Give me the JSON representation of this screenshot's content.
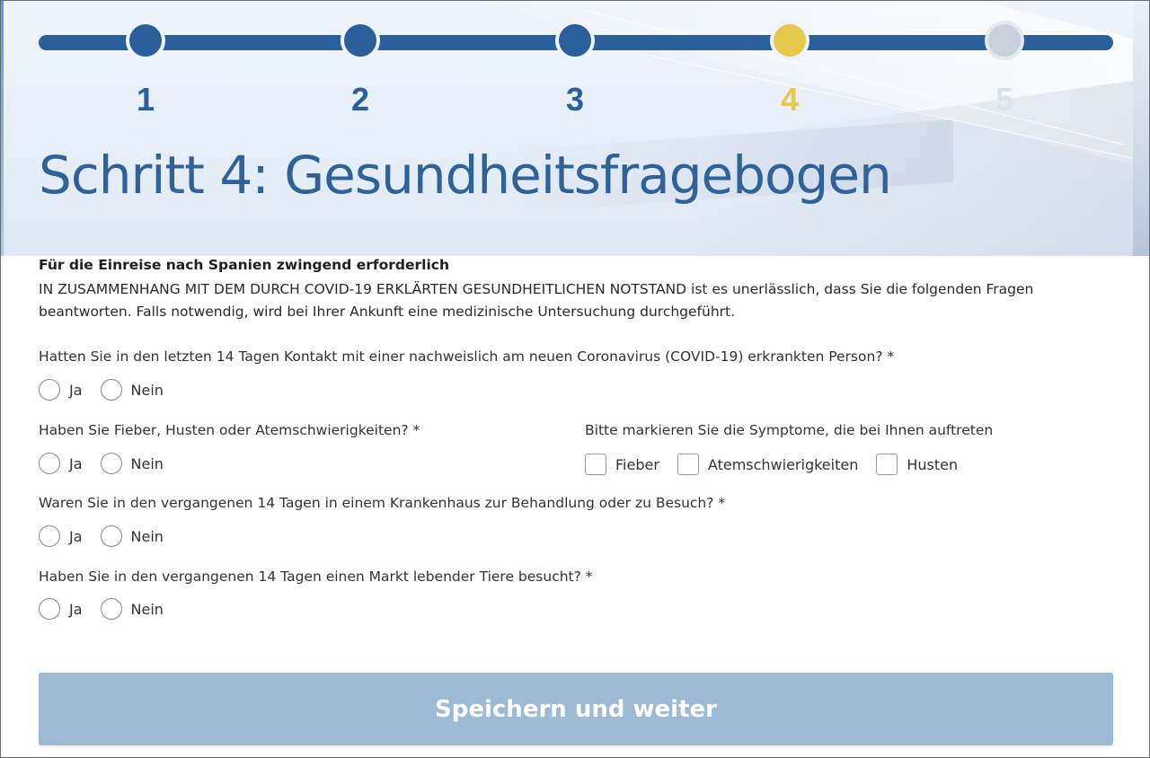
{
  "stepper": {
    "steps": [
      {
        "label": "1",
        "state": "done"
      },
      {
        "label": "2",
        "state": "done"
      },
      {
        "label": "3",
        "state": "done"
      },
      {
        "label": "4",
        "state": "current"
      },
      {
        "label": "5",
        "state": "future"
      }
    ]
  },
  "header": {
    "title": "Schritt 4: Gesundheitsfragebogen"
  },
  "intro": {
    "title": "Für die Einreise nach Spanien zwingend erforderlich",
    "text": "IN ZUSAMMENHANG MIT DEM DURCH COVID-19 ERKLÄRTEN GESUNDHEITLICHEN NOTSTAND ist es unerlässlich, dass Sie die folgenden Fragen beantworten. Falls notwendig, wird bei Ihrer Ankunft eine medizinische Untersuchung durchgeführt."
  },
  "questions": {
    "contact": {
      "label": "Hatten Sie in den letzten 14 Tagen Kontakt mit einer nachweislich am neuen Coronavirus (COVID-19) erkrankten Person? *",
      "yes": "Ja",
      "no": "Nein"
    },
    "fever": {
      "label": "Haben Sie Fieber, Husten oder Atemschwierigkeiten? *",
      "yes": "Ja",
      "no": "Nein"
    },
    "symptoms": {
      "label": "Bitte markieren Sie die Symptome, die bei Ihnen auftreten",
      "options": [
        "Fieber",
        "Atemschwierigkeiten",
        "Husten"
      ]
    },
    "hospital": {
      "label": "Waren Sie in den vergangenen 14 Tagen in einem Krankenhaus zur Behandlung oder zu Besuch? *",
      "yes": "Ja",
      "no": "Nein"
    },
    "market": {
      "label": "Haben Sie in den vergangenen 14 Tagen einen Markt lebender Tiere besucht? *",
      "yes": "Ja",
      "no": "Nein"
    }
  },
  "submit": {
    "label": "Speichern und weiter"
  },
  "colors": {
    "primary": "#2a5f9c",
    "current_step": "#e6c84a",
    "future_step": "#c8d0da",
    "title": "#2f6298",
    "button_disabled": "#9dbad5"
  }
}
